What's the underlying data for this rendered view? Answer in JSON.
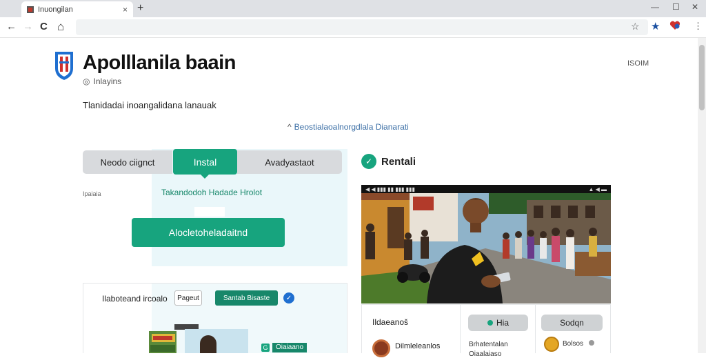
{
  "browser": {
    "tab_title": "Inuongilan",
    "tab_close": "×",
    "new_tab": "+",
    "minimize": "—",
    "maximize": "☐",
    "close": "✕",
    "back": "←",
    "forward": "→",
    "reload": "C",
    "home": "⌂",
    "bookmark": "☆",
    "ext_star": "★",
    "menu": "⋮"
  },
  "header": {
    "title": "Apolllanila baain",
    "subtitle": "Inlayins",
    "top_right": "ISOIM"
  },
  "tagline": "Tlanidadai inoangalidana lanauak",
  "center_link": "Beostialaoalnorgdlala Dianarati",
  "segments": {
    "left": "Neodo ciignct",
    "active": "Instal",
    "right": "Avadyastaot"
  },
  "left_panel": {
    "small_note": "Ipaiaia",
    "teal_heading": "Takandodoh Hadade Hrolot",
    "cta": "Alocletoheladaitnd"
  },
  "lower_card": {
    "label": "Ilaboteand ircoalo",
    "small_button": "Pageut",
    "teal_button": "Santab Bisaste",
    "check": "✓",
    "badge_icon": "G",
    "badge_text": "Oiaiaano"
  },
  "right_panel": {
    "check": "✓",
    "title": "Rentali",
    "video_status_left": "◀ ◀  ▮▮▮ ▮▮ ▮▮▮ ▮▮▮",
    "video_status_right": "▲ ◀ ▬",
    "bc_label": "Ildaeanoš",
    "pill_1": "Hia",
    "pill_2": "Sodqn",
    "avatar_a_text": "Dilmleleanlos",
    "sub_text": "Brhatentalan",
    "sub_text_2": "Oiaalaiaso",
    "avatar_b_text": "Bolsos"
  }
}
